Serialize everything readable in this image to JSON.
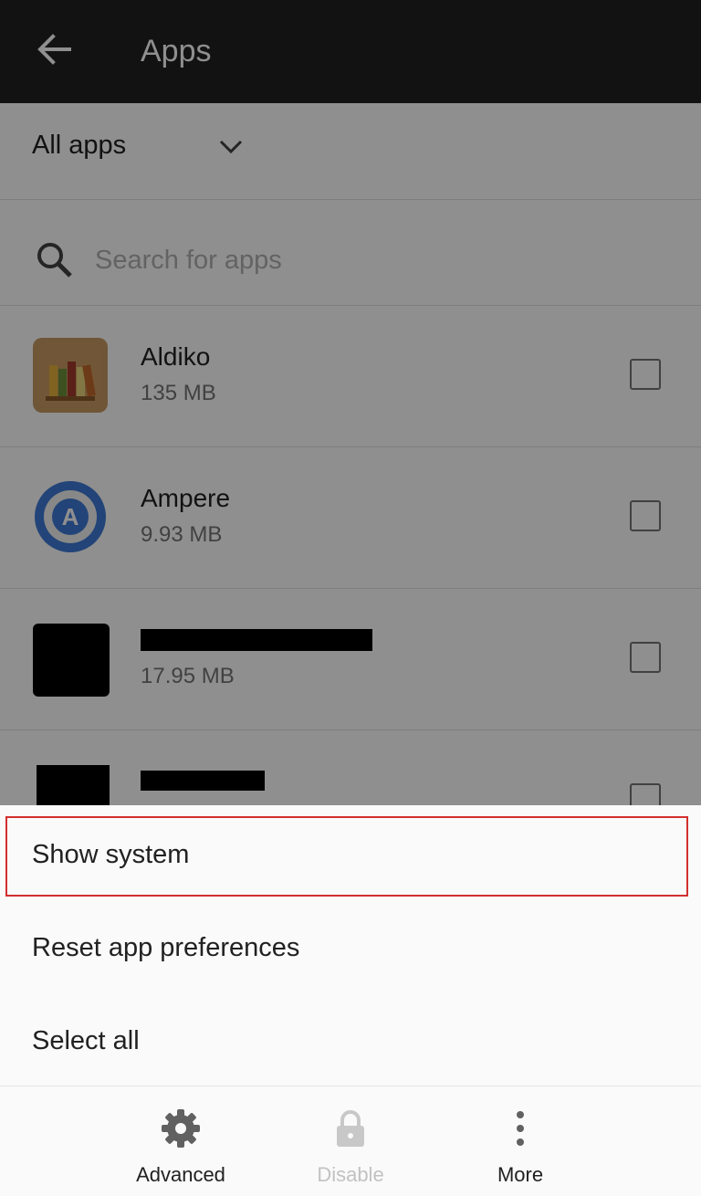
{
  "topbar": {
    "title": "Apps",
    "back_icon": "arrow-back-icon"
  },
  "filter": {
    "selected": "All apps",
    "icon": "chevron-down-icon"
  },
  "search": {
    "placeholder": "Search for apps",
    "value": "",
    "icon": "search-icon"
  },
  "apps": [
    {
      "name": "Aldiko",
      "size": "135 MB",
      "icon": "bookshelf-icon",
      "checked": false
    },
    {
      "name": "Ampere",
      "size": "9.93 MB",
      "icon": "ampere-a-icon",
      "checked": false
    },
    {
      "name": "",
      "size": "17.95 MB",
      "icon": "redacted-app-icon",
      "checked": false,
      "redacted": true
    },
    {
      "name": "",
      "size": "",
      "icon": "redacted-app-icon",
      "checked": false,
      "redacted": true
    }
  ],
  "menu": {
    "items": [
      {
        "label": "Show system",
        "highlighted": true
      },
      {
        "label": "Reset app preferences"
      },
      {
        "label": "Select all"
      }
    ],
    "highlight_color": "#d32f2f"
  },
  "bottom_nav": {
    "advanced": {
      "label": "Advanced",
      "icon": "gear-icon",
      "enabled": true
    },
    "disable": {
      "label": "Disable",
      "icon": "lock-icon",
      "enabled": false
    },
    "more": {
      "label": "More",
      "icon": "more-vert-icon",
      "enabled": true
    }
  },
  "colors": {
    "topbar": "#212121",
    "scrim": "rgba(0,0,0,0.44)",
    "ampere_blue": "#3d7ad6"
  }
}
